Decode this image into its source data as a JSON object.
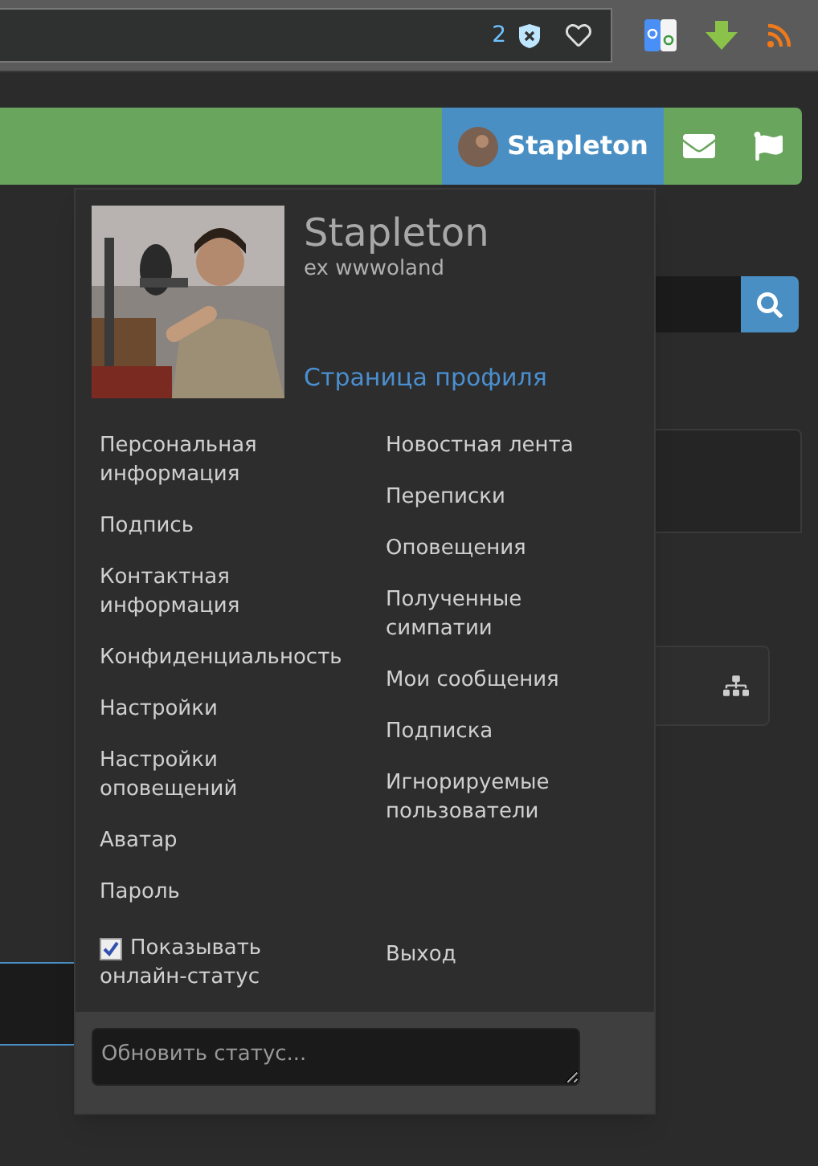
{
  "browser_toolbar": {
    "blocked_count": "2"
  },
  "navbar": {
    "user_name": "Stapleton"
  },
  "user_menu": {
    "name": "Stapleton",
    "title": "ex wwwoland",
    "profile_link": "Страница профиля",
    "left_items": [
      "Персональная информация",
      "Подпись",
      "Контактная информация",
      "Конфиденциальность",
      "Настройки",
      "Настройки оповещений",
      "Аватар",
      "Пароль"
    ],
    "right_items": [
      "Новостная лента",
      "Переписки",
      "Оповещения",
      "Полученные симпатии",
      "Мои сообщения",
      "Подписка",
      "Игнорируемые пользователи"
    ],
    "online_status": {
      "label": "Показывать онлайн-статус",
      "checked": true
    },
    "logout": "Выход",
    "status": {
      "placeholder": "Обновить статус..."
    }
  }
}
